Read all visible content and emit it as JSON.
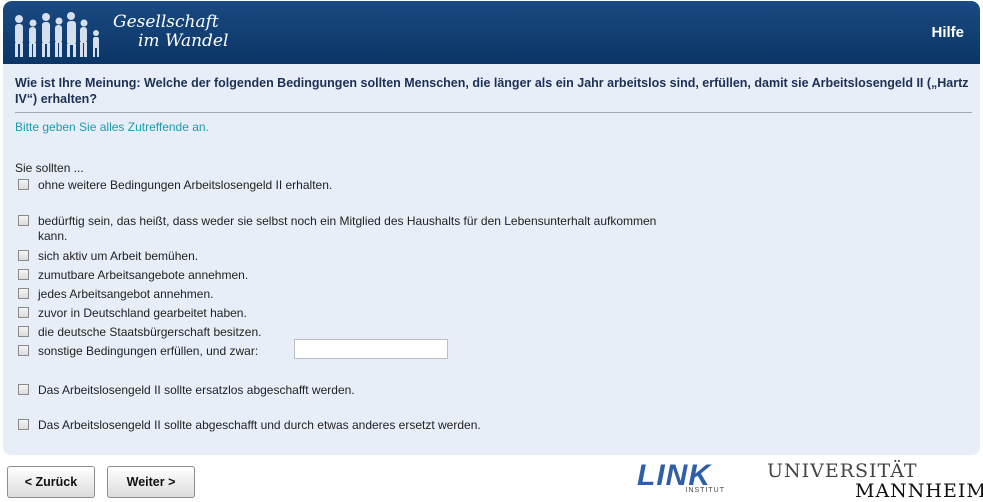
{
  "header": {
    "brand_line1": "Gesellschaft",
    "brand_line2": "im Wandel",
    "help_label": "Hilfe"
  },
  "question": {
    "text": "Wie ist Ihre Meinung: Welche der folgenden Bedingungen sollten Menschen, die länger als ein Jahr arbeitslos sind, erfüllen, damit sie Arbeitslosengeld II („Hartz IV“) erhalten?",
    "instruction": "Bitte geben Sie alles Zutreffende an.",
    "intro": "Sie sollten ..."
  },
  "options": [
    {
      "label": "ohne weitere Bedingungen Arbeitslosengeld II erhalten.",
      "checked": false
    },
    {
      "label": "bedürftig sein, das heißt, dass weder sie selbst noch ein Mitglied des Haushalts für den Lebensunterhalt aufkommen kann.",
      "checked": false
    },
    {
      "label": "sich aktiv um Arbeit bemühen.",
      "checked": false
    },
    {
      "label": "zumutbare Arbeitsangebote annehmen.",
      "checked": false
    },
    {
      "label": "jedes Arbeitsangebot annehmen.",
      "checked": false
    },
    {
      "label": "zuvor in Deutschland gearbeitet haben.",
      "checked": false
    },
    {
      "label": "die deutsche Staatsbürgerschaft besitzen.",
      "checked": false
    },
    {
      "label": "sonstige Bedingungen erfüllen, und zwar:",
      "checked": false,
      "input_value": ""
    },
    {
      "label": "Das Arbeitslosengeld II sollte ersatzlos abgeschafft werden.",
      "checked": false
    },
    {
      "label": "Das Arbeitslosengeld II sollte abgeschafft und durch etwas anderes ersetzt werden.",
      "checked": false
    }
  ],
  "nav": {
    "back_label": "< Zurück",
    "next_label": "Weiter >"
  },
  "logos": {
    "link_text": "LINK",
    "link_sub": "INSTITUT",
    "uni_line1": "UNIVERSITÄT",
    "uni_line2": "MANNHEIM"
  },
  "colors": {
    "header_bg": "#0e3a6d",
    "panel_bg": "#e7eef8",
    "question_text": "#1d2f55",
    "instruction_text": "#1c9bb0",
    "link_logo": "#2e5fa8"
  }
}
